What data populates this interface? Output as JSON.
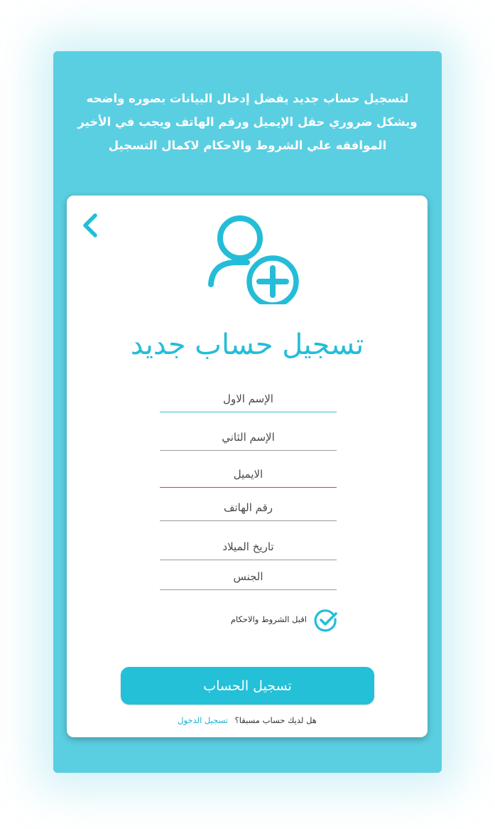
{
  "intro_text": "لتسجيل حساب جديد يفضل إدخال البيانات بصوره واضحه وبشكل ضروري حقل الإيميل ورقم الهاتف ويجب في الأخير الموافقه علي الشروط والاحكام لاكمال التسجيل",
  "page_title": "تسجيل حساب جديد",
  "icons": {
    "back": "chevron-left-icon",
    "avatar": "user-add-icon",
    "terms_check": "check-circle-icon"
  },
  "colors": {
    "panel_bg": "#5bcfe2",
    "accent": "#24bdd8",
    "error": "#e53935"
  },
  "form": {
    "first_name_placeholder": "الإسم الاول",
    "last_name_placeholder": "الإسم الثاني",
    "email_placeholder": "الايميل",
    "phone_placeholder": "رقم الهاتف",
    "birthdate_placeholder": "تاريخ الميلاد",
    "gender_placeholder": "الجنس",
    "terms_label": "اقبل الشروط والاحكام",
    "submit_label": "تسجيل الحساب"
  },
  "footer": {
    "question": "هل لديك حساب مسبقا؟",
    "login_link": "تسجيل الدخول"
  }
}
